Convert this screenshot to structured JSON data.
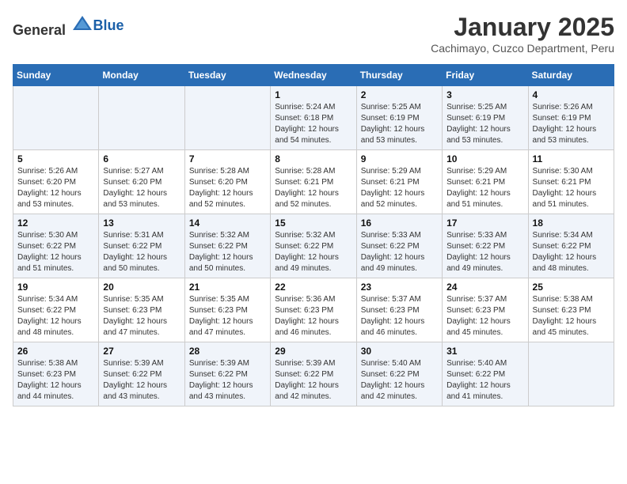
{
  "header": {
    "logo_general": "General",
    "logo_blue": "Blue",
    "title": "January 2025",
    "subtitle": "Cachimayo, Cuzco Department, Peru"
  },
  "days_of_week": [
    "Sunday",
    "Monday",
    "Tuesday",
    "Wednesday",
    "Thursday",
    "Friday",
    "Saturday"
  ],
  "weeks": [
    [
      {
        "day": "",
        "info": ""
      },
      {
        "day": "",
        "info": ""
      },
      {
        "day": "",
        "info": ""
      },
      {
        "day": "1",
        "info": "Sunrise: 5:24 AM\nSunset: 6:18 PM\nDaylight: 12 hours and 54 minutes."
      },
      {
        "day": "2",
        "info": "Sunrise: 5:25 AM\nSunset: 6:19 PM\nDaylight: 12 hours and 53 minutes."
      },
      {
        "day": "3",
        "info": "Sunrise: 5:25 AM\nSunset: 6:19 PM\nDaylight: 12 hours and 53 minutes."
      },
      {
        "day": "4",
        "info": "Sunrise: 5:26 AM\nSunset: 6:19 PM\nDaylight: 12 hours and 53 minutes."
      }
    ],
    [
      {
        "day": "5",
        "info": "Sunrise: 5:26 AM\nSunset: 6:20 PM\nDaylight: 12 hours and 53 minutes."
      },
      {
        "day": "6",
        "info": "Sunrise: 5:27 AM\nSunset: 6:20 PM\nDaylight: 12 hours and 53 minutes."
      },
      {
        "day": "7",
        "info": "Sunrise: 5:28 AM\nSunset: 6:20 PM\nDaylight: 12 hours and 52 minutes."
      },
      {
        "day": "8",
        "info": "Sunrise: 5:28 AM\nSunset: 6:21 PM\nDaylight: 12 hours and 52 minutes."
      },
      {
        "day": "9",
        "info": "Sunrise: 5:29 AM\nSunset: 6:21 PM\nDaylight: 12 hours and 52 minutes."
      },
      {
        "day": "10",
        "info": "Sunrise: 5:29 AM\nSunset: 6:21 PM\nDaylight: 12 hours and 51 minutes."
      },
      {
        "day": "11",
        "info": "Sunrise: 5:30 AM\nSunset: 6:21 PM\nDaylight: 12 hours and 51 minutes."
      }
    ],
    [
      {
        "day": "12",
        "info": "Sunrise: 5:30 AM\nSunset: 6:22 PM\nDaylight: 12 hours and 51 minutes."
      },
      {
        "day": "13",
        "info": "Sunrise: 5:31 AM\nSunset: 6:22 PM\nDaylight: 12 hours and 50 minutes."
      },
      {
        "day": "14",
        "info": "Sunrise: 5:32 AM\nSunset: 6:22 PM\nDaylight: 12 hours and 50 minutes."
      },
      {
        "day": "15",
        "info": "Sunrise: 5:32 AM\nSunset: 6:22 PM\nDaylight: 12 hours and 49 minutes."
      },
      {
        "day": "16",
        "info": "Sunrise: 5:33 AM\nSunset: 6:22 PM\nDaylight: 12 hours and 49 minutes."
      },
      {
        "day": "17",
        "info": "Sunrise: 5:33 AM\nSunset: 6:22 PM\nDaylight: 12 hours and 49 minutes."
      },
      {
        "day": "18",
        "info": "Sunrise: 5:34 AM\nSunset: 6:22 PM\nDaylight: 12 hours and 48 minutes."
      }
    ],
    [
      {
        "day": "19",
        "info": "Sunrise: 5:34 AM\nSunset: 6:22 PM\nDaylight: 12 hours and 48 minutes."
      },
      {
        "day": "20",
        "info": "Sunrise: 5:35 AM\nSunset: 6:23 PM\nDaylight: 12 hours and 47 minutes."
      },
      {
        "day": "21",
        "info": "Sunrise: 5:35 AM\nSunset: 6:23 PM\nDaylight: 12 hours and 47 minutes."
      },
      {
        "day": "22",
        "info": "Sunrise: 5:36 AM\nSunset: 6:23 PM\nDaylight: 12 hours and 46 minutes."
      },
      {
        "day": "23",
        "info": "Sunrise: 5:37 AM\nSunset: 6:23 PM\nDaylight: 12 hours and 46 minutes."
      },
      {
        "day": "24",
        "info": "Sunrise: 5:37 AM\nSunset: 6:23 PM\nDaylight: 12 hours and 45 minutes."
      },
      {
        "day": "25",
        "info": "Sunrise: 5:38 AM\nSunset: 6:23 PM\nDaylight: 12 hours and 45 minutes."
      }
    ],
    [
      {
        "day": "26",
        "info": "Sunrise: 5:38 AM\nSunset: 6:23 PM\nDaylight: 12 hours and 44 minutes."
      },
      {
        "day": "27",
        "info": "Sunrise: 5:39 AM\nSunset: 6:22 PM\nDaylight: 12 hours and 43 minutes."
      },
      {
        "day": "28",
        "info": "Sunrise: 5:39 AM\nSunset: 6:22 PM\nDaylight: 12 hours and 43 minutes."
      },
      {
        "day": "29",
        "info": "Sunrise: 5:39 AM\nSunset: 6:22 PM\nDaylight: 12 hours and 42 minutes."
      },
      {
        "day": "30",
        "info": "Sunrise: 5:40 AM\nSunset: 6:22 PM\nDaylight: 12 hours and 42 minutes."
      },
      {
        "day": "31",
        "info": "Sunrise: 5:40 AM\nSunset: 6:22 PM\nDaylight: 12 hours and 41 minutes."
      },
      {
        "day": "",
        "info": ""
      }
    ]
  ]
}
